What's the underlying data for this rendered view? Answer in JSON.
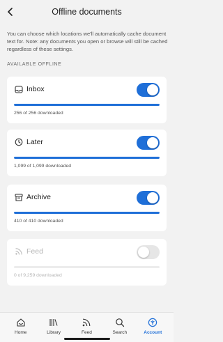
{
  "header": {
    "title": "Offline documents",
    "back_icon": "chevron-left-icon"
  },
  "description": "You can choose which locations we'll automatically cache document text for. Note: any documents you open or browse will still be cached regardless of these settings.",
  "section_label": "AVAILABLE OFFLINE",
  "locations": [
    {
      "label": "Inbox",
      "icon": "inbox-icon",
      "enabled": true,
      "downloaded_text": "256 of 256 downloaded",
      "progress": 1.0
    },
    {
      "label": "Later",
      "icon": "clock-icon",
      "enabled": true,
      "downloaded_text": "1,099 of 1,099 downloaded",
      "progress": 1.0
    },
    {
      "label": "Archive",
      "icon": "archive-icon",
      "enabled": true,
      "downloaded_text": "410 of 410 downloaded",
      "progress": 1.0
    },
    {
      "label": "Feed",
      "icon": "rss-icon",
      "enabled": false,
      "downloaded_text": "0 of 9,259 downloaded",
      "progress": 0.0
    }
  ],
  "tabs": [
    {
      "label": "Home",
      "icon": "home-icon",
      "active": false
    },
    {
      "label": "Library",
      "icon": "library-icon",
      "active": false
    },
    {
      "label": "Feed",
      "icon": "rss-icon",
      "active": false
    },
    {
      "label": "Search",
      "icon": "search-icon",
      "active": false
    },
    {
      "label": "Account",
      "icon": "account-icon",
      "active": true
    }
  ],
  "colors": {
    "accent": "#1f6fd8",
    "background": "#f2f2f2",
    "card": "#ffffff",
    "disabled_text": "#b5b5b5"
  }
}
